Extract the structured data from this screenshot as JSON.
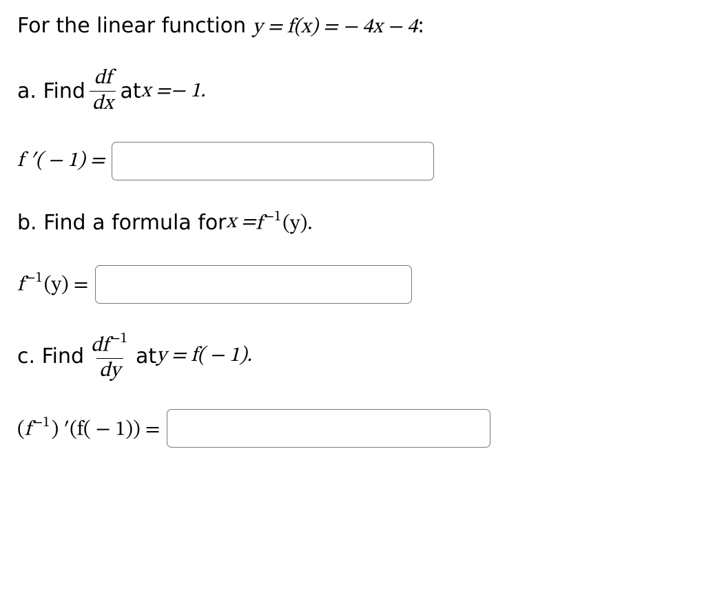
{
  "intro": {
    "prefix": "For the linear function ",
    "eq1": "y = f(x) = ",
    "eq2": "− 4x − 4",
    "suffix": ":"
  },
  "a": {
    "label": "a. Find ",
    "frac_num": "df",
    "frac_den": "dx",
    "at": " at ",
    "xeq": "x = ",
    "val": " − 1.",
    "answer_lhs": "f ′( − 1) = "
  },
  "b": {
    "label": "b. Find a formula for ",
    "xeq": "x = ",
    "finv": "f",
    "exp": "−1",
    "yparen": "(y).",
    "answer_lhs_f": "f",
    "answer_lhs_exp": "−1",
    "answer_lhs_yparen": "(y) = "
  },
  "c": {
    "label": "c. Find ",
    "frac_num_main": "df",
    "frac_num_exp": "−1",
    "frac_den": "dy",
    "at": " at ",
    "yeq": "y = f( − 1).",
    "answer_open": "(",
    "answer_f": "f",
    "answer_exp": "−1",
    "answer_close_prime": ") ′",
    "answer_arg": "(f( − 1)) = "
  }
}
